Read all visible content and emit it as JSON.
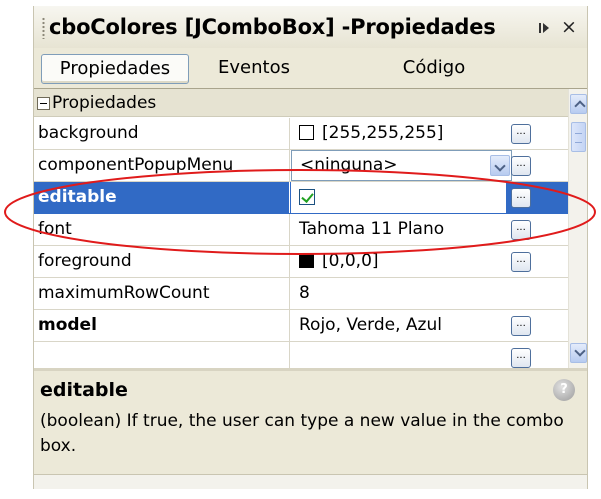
{
  "window": {
    "title": "cboColores [JComboBox] -Propiedades",
    "pin_icon": "pin-icon",
    "close_glyph": "×"
  },
  "tabs": [
    {
      "label": "Propiedades",
      "active": true
    },
    {
      "label": "Eventos",
      "active": false
    },
    {
      "label": "Código",
      "active": false
    }
  ],
  "section": {
    "label": "Propiedades",
    "expanded": true
  },
  "rows": [
    {
      "name": "background",
      "value": "[255,255,255]",
      "swatch": "#ffffff",
      "editor": "dots"
    },
    {
      "name": "componentPopupMenu",
      "value": "<ninguna>",
      "editor": "combo+dots"
    },
    {
      "name": "editable",
      "value": "true",
      "checkbox": true,
      "selected": true,
      "bold": true,
      "editor": "dots"
    },
    {
      "name": "font",
      "value": "Tahoma 11 Plano",
      "editor": "dots"
    },
    {
      "name": "foreground",
      "value": "[0,0,0]",
      "swatch": "#000000",
      "editor": "dots"
    },
    {
      "name": "maximumRowCount",
      "value": "8",
      "editor": "none"
    },
    {
      "name": "model",
      "value": "Rojo, Verde, Azul",
      "bold": true,
      "editor": "dots"
    }
  ],
  "description": {
    "title": "editable",
    "text": "(boolean)  If true, the user can type a new value in the combo box."
  },
  "help_icon": "help-icon",
  "colors": {
    "selection": "#316ac5",
    "panel": "#ece9d8",
    "annotation": "#e01b1b"
  }
}
